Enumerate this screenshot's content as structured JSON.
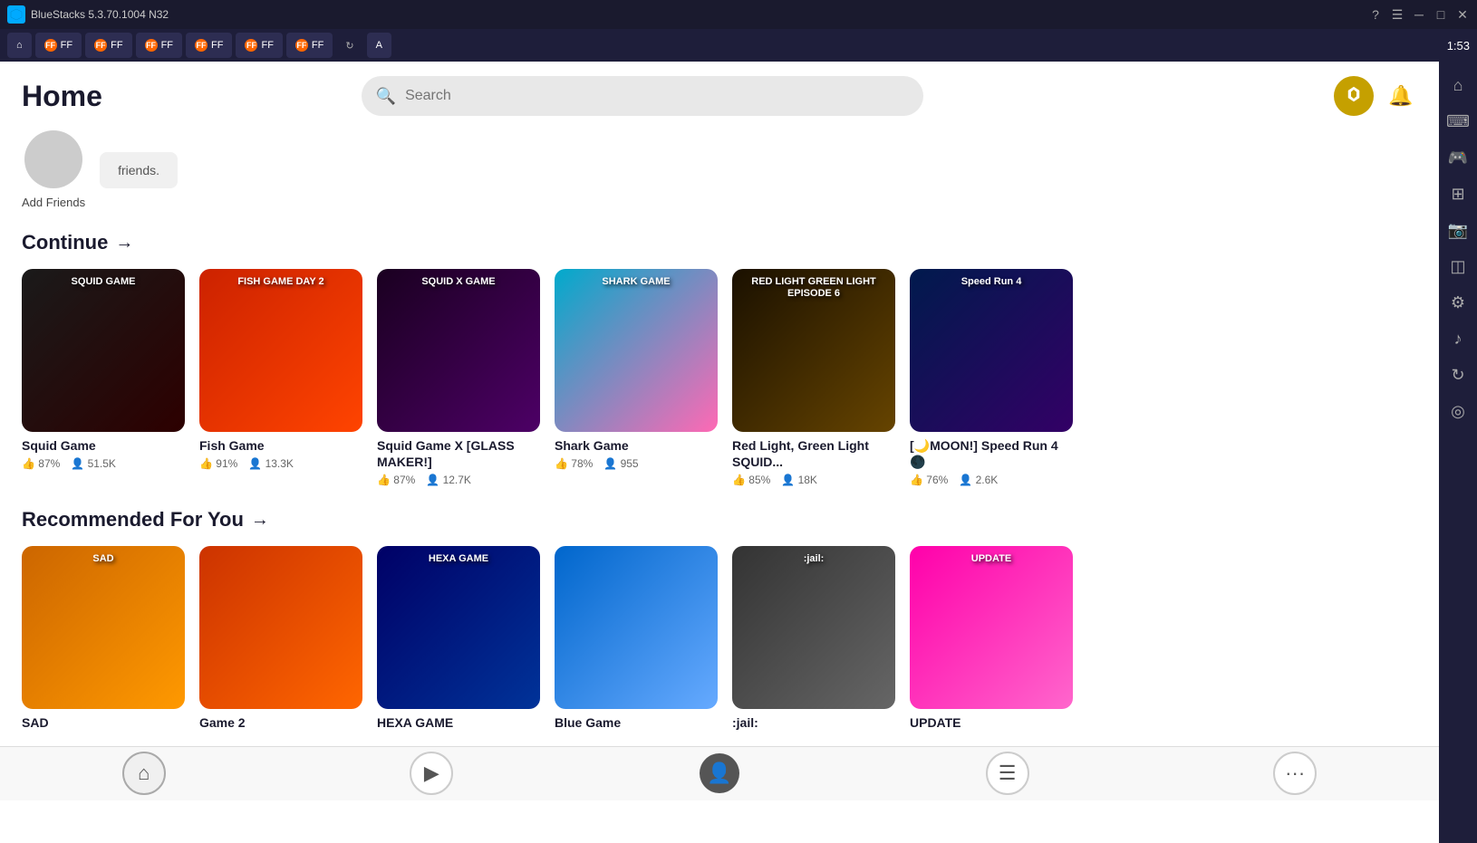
{
  "titlebar": {
    "app_name": "BlueStacks 5.3.70.1004 N32",
    "time": "1:53",
    "tabs": [
      {
        "label": "FF",
        "id": "tab1"
      },
      {
        "label": "FF",
        "id": "tab2"
      },
      {
        "label": "FF",
        "id": "tab3"
      },
      {
        "label": "FF",
        "id": "tab4"
      },
      {
        "label": "FF",
        "id": "tab5"
      },
      {
        "label": "FF",
        "id": "tab6"
      }
    ]
  },
  "header": {
    "title": "Home",
    "search_placeholder": "Search",
    "time": "1:53"
  },
  "friends": {
    "add_label": "Add Friends",
    "placeholder_text": "friends."
  },
  "continue_section": {
    "title": "Continue",
    "arrow": "→",
    "games": [
      {
        "title": "Squid Game",
        "likes": "87%",
        "players": "51.5K",
        "thumb_class": "thumb-squid",
        "thumb_text": "SQUID GAME"
      },
      {
        "title": "Fish Game",
        "likes": "91%",
        "players": "13.3K",
        "thumb_class": "thumb-fish",
        "thumb_text": "FISH GAME DAY 2"
      },
      {
        "title": "Squid Game X [GLASS MAKER!]",
        "likes": "87%",
        "players": "12.7K",
        "thumb_class": "thumb-squidx",
        "thumb_text": "SQUID X GAME"
      },
      {
        "title": "Shark Game",
        "likes": "78%",
        "players": "955",
        "thumb_class": "thumb-shark",
        "thumb_text": "SHARK GAME"
      },
      {
        "title": "Red Light, Green Light SQUID...",
        "likes": "85%",
        "players": "18K",
        "thumb_class": "thumb-redlight",
        "thumb_text": "RED LIGHT GREEN LIGHT EPISODE 6"
      },
      {
        "title": "[🌙MOON!] Speed Run 4 🌑",
        "likes": "76%",
        "players": "2.6K",
        "thumb_class": "thumb-speedrun",
        "thumb_text": "Speed Run 4"
      }
    ]
  },
  "recommended_section": {
    "title": "Recommended For You",
    "arrow": "→",
    "games": [
      {
        "title": "SAD",
        "likes": "",
        "players": "",
        "thumb_class": "thumb-sad",
        "thumb_text": "SAD"
      },
      {
        "title": "Game 2",
        "likes": "",
        "players": "",
        "thumb_class": "thumb-game2",
        "thumb_text": ""
      },
      {
        "title": "HEXA GAME",
        "likes": "",
        "players": "",
        "thumb_class": "thumb-hexa",
        "thumb_text": "HEXA GAME"
      },
      {
        "title": "Blue Game",
        "likes": "",
        "players": "",
        "thumb_class": "thumb-blue",
        "thumb_text": ""
      },
      {
        "title": ":jail:",
        "likes": "",
        "players": "",
        "thumb_class": "thumb-jail",
        "thumb_text": ":jail:"
      },
      {
        "title": "UPDATE",
        "likes": "",
        "players": "",
        "thumb_class": "thumb-update",
        "thumb_text": "UPDATE"
      }
    ]
  },
  "right_sidebar": {
    "icons": [
      {
        "name": "home-icon",
        "symbol": "⌂"
      },
      {
        "name": "keyboard-icon",
        "symbol": "⌨"
      },
      {
        "name": "gamepad-icon",
        "symbol": "🎮"
      },
      {
        "name": "grid-icon",
        "symbol": "⊞"
      },
      {
        "name": "camera-icon",
        "symbol": "📷"
      },
      {
        "name": "layers-icon",
        "symbol": "◫"
      },
      {
        "name": "settings-icon",
        "symbol": "⚙"
      },
      {
        "name": "volume-icon",
        "symbol": "♪"
      },
      {
        "name": "rotate-icon",
        "symbol": "↻"
      },
      {
        "name": "location-icon",
        "symbol": "◎"
      }
    ]
  },
  "bottom_nav": {
    "items": [
      {
        "name": "home-nav",
        "symbol": "⌂"
      },
      {
        "name": "play-nav",
        "symbol": "▶"
      },
      {
        "name": "avatar-nav",
        "symbol": "👤"
      },
      {
        "name": "chat-nav",
        "symbol": "☰"
      },
      {
        "name": "more-nav",
        "symbol": "•••"
      }
    ]
  }
}
